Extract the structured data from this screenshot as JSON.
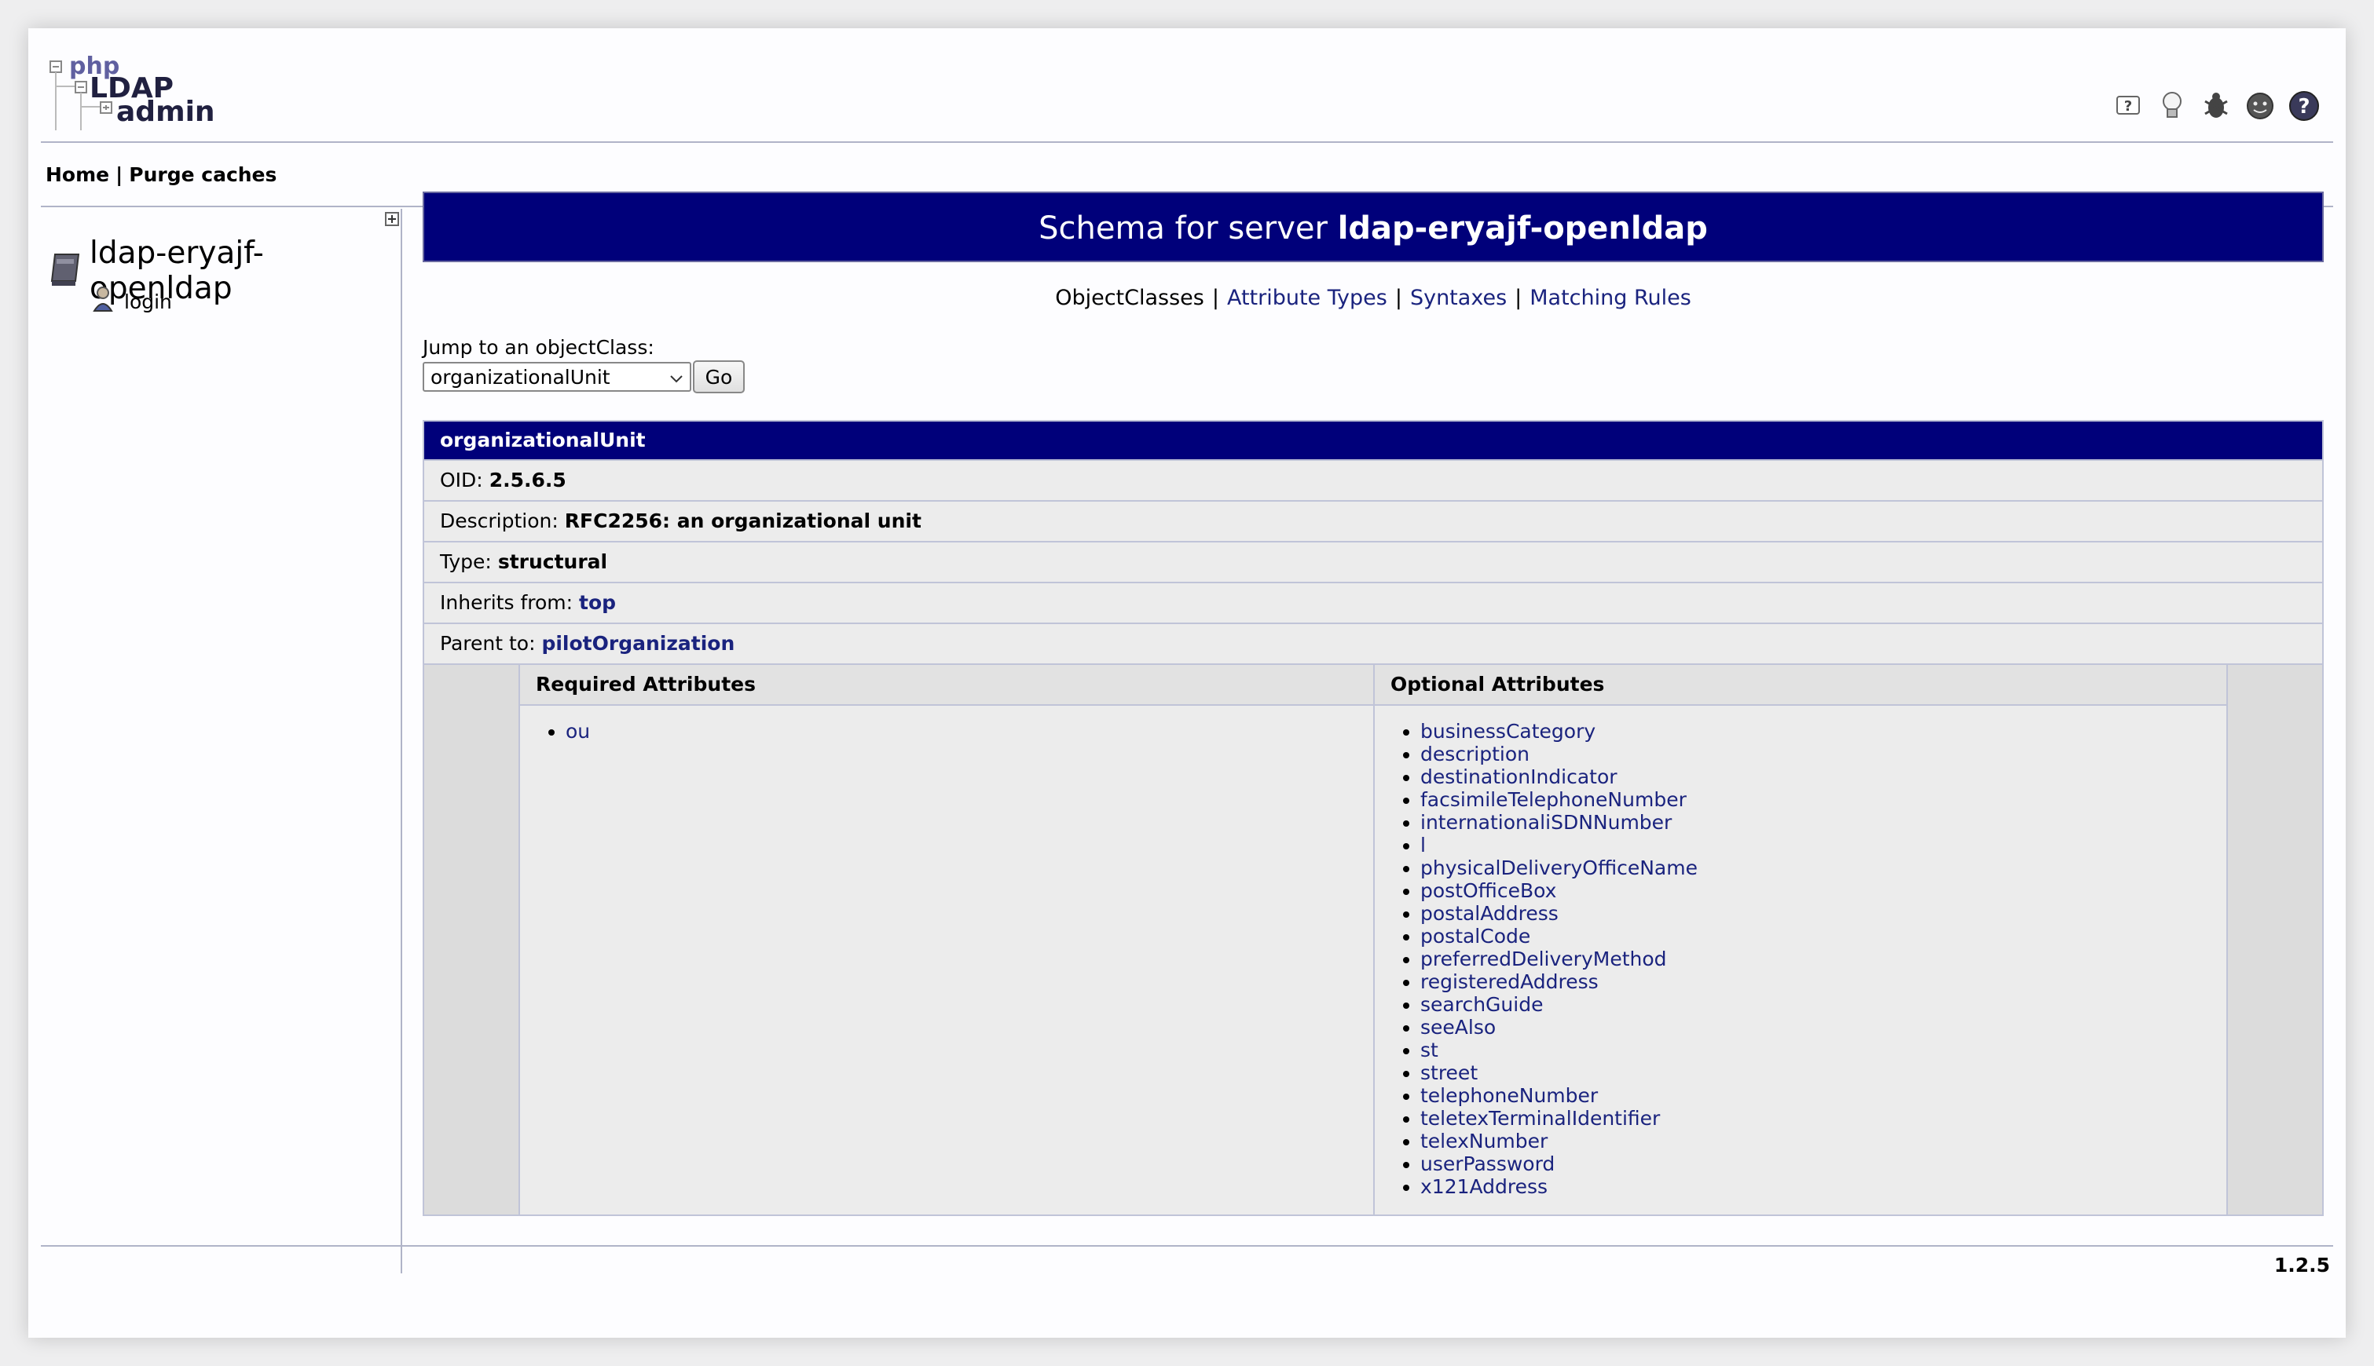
{
  "menu": {
    "home": "Home",
    "separator": "|",
    "purge": "Purge caches"
  },
  "logo": {
    "php": "php",
    "ldap": "LDAP",
    "admin": "admin"
  },
  "toolbar_icons": [
    "help-icon",
    "lightbulb-icon",
    "bug-icon",
    "donate-icon",
    "support-icon"
  ],
  "sidebar": {
    "server_name": "ldap-eryajf-openldap",
    "login_label": "login"
  },
  "main": {
    "title_prefix": "Schema for server",
    "title_server": "ldap-eryajf-openldap",
    "tabs": {
      "objectclasses": "ObjectClasses",
      "attribute_types": "Attribute Types",
      "syntaxes": "Syntaxes",
      "matching_rules": "Matching Rules",
      "separator": "|"
    },
    "jump_label": "Jump to an objectClass:",
    "selected_class": "organizationalUnit",
    "go_label": "Go"
  },
  "object_class": {
    "name": "organizationalUnit",
    "oid_label": "OID:",
    "oid": "2.5.6.5",
    "description_label": "Description:",
    "description": "RFC2256: an organizational unit",
    "type_label": "Type:",
    "type": "structural",
    "inherits_label": "Inherits from:",
    "inherits": "top",
    "parent_label": "Parent to:",
    "parent": "pilotOrganization",
    "required_header": "Required Attributes",
    "optional_header": "Optional Attributes",
    "required": [
      "ou"
    ],
    "optional": [
      "businessCategory",
      "description",
      "destinationIndicator",
      "facsimileTelephoneNumber",
      "internationaliSDNNumber",
      "l",
      "physicalDeliveryOfficeName",
      "postOfficeBox",
      "postalAddress",
      "postalCode",
      "preferredDeliveryMethod",
      "registeredAddress",
      "searchGuide",
      "seeAlso",
      "st",
      "street",
      "telephoneNumber",
      "teletexTerminalIdentifier",
      "telexNumber",
      "userPassword",
      "x121Address"
    ]
  },
  "footer": {
    "version": "1.2.5"
  },
  "colors": {
    "banner": "#00007a",
    "link": "#1a237e",
    "panel": "#ececec"
  }
}
